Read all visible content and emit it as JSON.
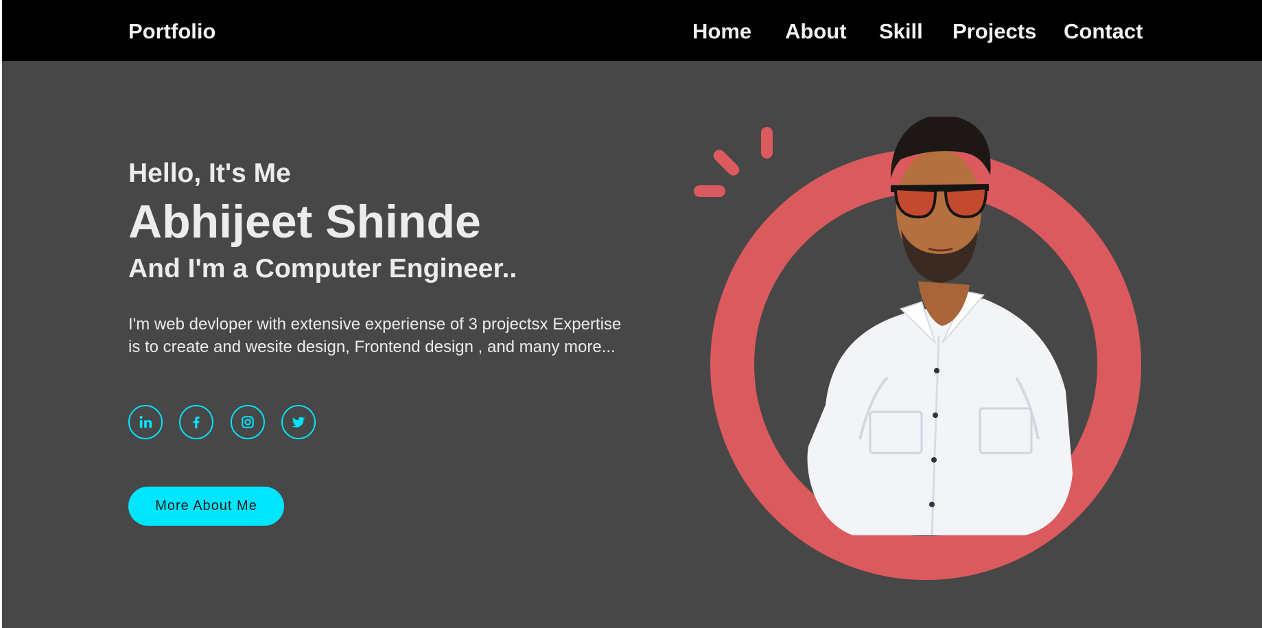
{
  "nav": {
    "brand": "Portfolio",
    "links": [
      "Home",
      "About",
      "Skill",
      "Projects",
      "Contact"
    ]
  },
  "hero": {
    "greeting": "Hello, It's Me",
    "name": "Abhijeet Shinde",
    "role": "And I'm a Computer Engineer..",
    "description": "I'm web devloper with extensive experiense of 3 projectsx Expertise is to create and wesite design, Frontend design , and many more...",
    "cta_label": "More About Me"
  },
  "socials": [
    {
      "icon": "linkedin-icon"
    },
    {
      "icon": "facebook-icon"
    },
    {
      "icon": "instagram-icon"
    },
    {
      "icon": "twitter-icon"
    }
  ],
  "colors": {
    "background": "#474747",
    "navbar": "#000000",
    "accent": "#00e5ff",
    "ring": "#db5a5e",
    "text": "#ececec"
  }
}
